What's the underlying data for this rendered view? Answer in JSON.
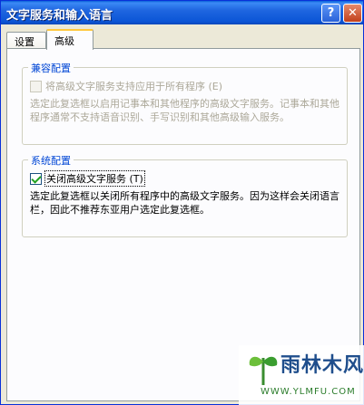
{
  "window": {
    "title": "文字服务和输入语言",
    "help_glyph": "?",
    "close_glyph": "✕"
  },
  "tabs": [
    {
      "label": "设置",
      "selected": false
    },
    {
      "label": "高级",
      "selected": true
    }
  ],
  "compat_group": {
    "title": "兼容配置",
    "checkbox_label": "将高级文字服务支持应用于所有程序 (E)",
    "checked": false,
    "enabled": false,
    "description": "选定此复选框以启用记事本和其他程序的高级文字服务。记事本和其他程序通常不支持语音识别、手写识别和其他高级输入服务。"
  },
  "system_group": {
    "title": "系统配置",
    "checkbox_label": "关闭高级文字服务 (T)",
    "checked": true,
    "enabled": true,
    "description": "选定此复选框以关闭所有程序中的高级文字服务。因为这样会关闭语言栏，因此不推荐东亚用户选定此复选框。"
  },
  "watermark": {
    "brand": "雨林木风",
    "url": "WWW.YLMFU.COM"
  }
}
